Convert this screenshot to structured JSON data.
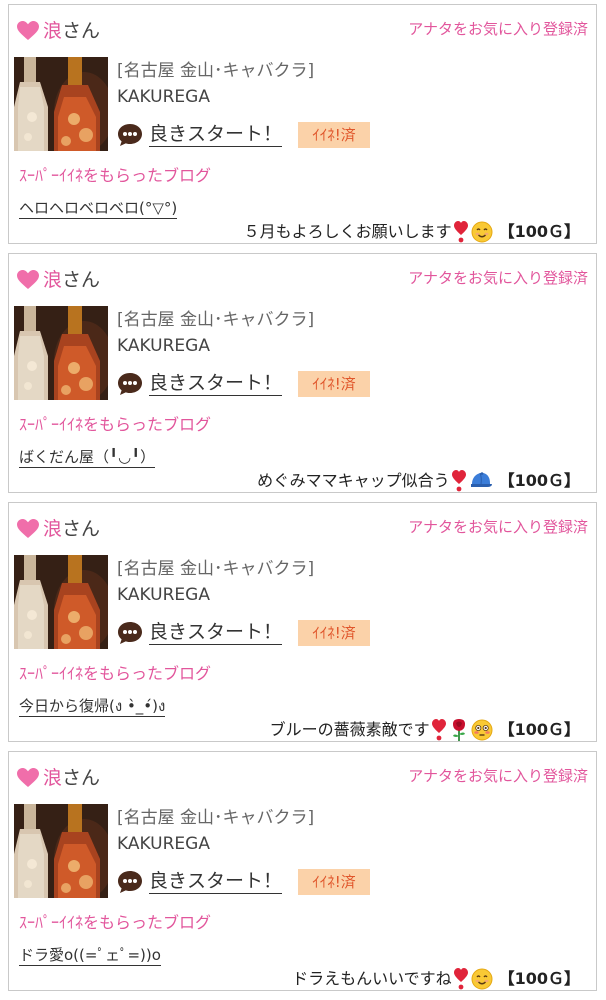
{
  "colors": {
    "accent_pink": "#e2569c",
    "badge_bg": "#fbd2a9",
    "badge_text": "#e0562b",
    "card_border": "#c9c9c9"
  },
  "entries": [
    {
      "user_name": "浪",
      "honorific": "さん",
      "fav_status": "アナタをお気に入り登録済",
      "shop_area": "[名古屋 金山･キャバクラ]",
      "shop_name": "KAKUREGA",
      "blog_title": "良きスタート！",
      "like_badge": "ｲｲﾈ!済",
      "section_label": "ｽｰﾊﾟｰｲｲﾈをもらったブログ",
      "liked_blog": "ヘロヘロベロベロ(°▽°)",
      "gift_message": "５月もよろしくお願いします",
      "gift_icons": [
        "heart-exclamation-icon",
        "smiling-face-icon"
      ],
      "gift_amount": "【100Ｇ】"
    },
    {
      "user_name": "浪",
      "honorific": "さん",
      "fav_status": "アナタをお気に入り登録済",
      "shop_area": "[名古屋 金山･キャバクラ]",
      "shop_name": "KAKUREGA",
      "blog_title": "良きスタート！",
      "like_badge": "ｲｲﾈ!済",
      "section_label": "ｽｰﾊﾟｰｲｲﾈをもらったブログ",
      "liked_blog": "ばくだん屋（╹◡╹）",
      "gift_message": "めぐみママキャップ似合う",
      "gift_icons": [
        "heart-exclamation-icon",
        "blue-cap-icon"
      ],
      "gift_amount": "【100Ｇ】"
    },
    {
      "user_name": "浪",
      "honorific": "さん",
      "fav_status": "アナタをお気に入り登録済",
      "shop_area": "[名古屋 金山･キャバクラ]",
      "shop_name": "KAKUREGA",
      "blog_title": "良きスタート！",
      "like_badge": "ｲｲﾈ!済",
      "section_label": "ｽｰﾊﾟｰｲｲﾈをもらったブログ",
      "liked_blog": "今日から復帰(ง •̀_•́)ง",
      "gift_message": "ブルーの薔薇素敵です",
      "gift_icons": [
        "heart-exclamation-icon",
        "rose-icon",
        "flushed-face-icon"
      ],
      "gift_amount": "【100Ｇ】"
    },
    {
      "user_name": "浪",
      "honorific": "さん",
      "fav_status": "アナタをお気に入り登録済",
      "shop_area": "[名古屋 金山･キャバクラ]",
      "shop_name": "KAKUREGA",
      "blog_title": "良きスタート！",
      "like_badge": "ｲｲﾈ!済",
      "section_label": "ｽｰﾊﾟｰｲｲﾈをもらったブログ",
      "liked_blog": "ドラ愛o((=ﾟェﾟ=))o",
      "gift_message": "ドラえもんいいですね",
      "gift_icons": [
        "heart-exclamation-icon",
        "smiling-face-icon"
      ],
      "gift_amount": "【100Ｇ】"
    }
  ]
}
